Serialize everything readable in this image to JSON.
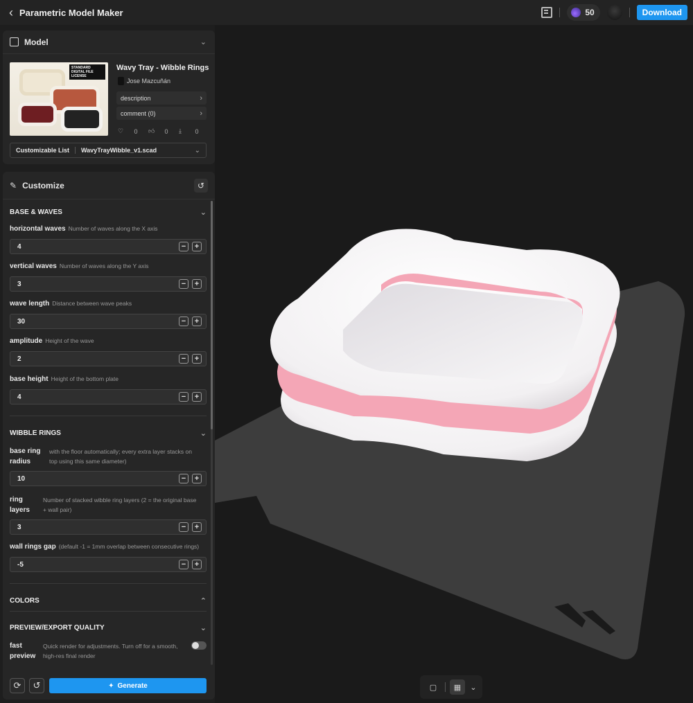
{
  "header": {
    "title": "Parametric Model Maker",
    "credits": "50",
    "download_label": "Download"
  },
  "model": {
    "panel_title": "Model",
    "name": "Wavy Tray - Wibble Rings",
    "author": "Jose Mazcuñán",
    "license_badge": "STANDARD DIGITAL FILE LICENSE",
    "description_label": "description",
    "comment_label": "comment  (0)",
    "likes": "0",
    "thumbs": "0",
    "downloads": "0",
    "file_list_label": "Customizable List",
    "file_name": "WavyTrayWibble_v1.scad"
  },
  "customize": {
    "panel_title": "Customize",
    "sections": {
      "base_waves": "BASE & WAVES",
      "wibble_rings": "WIBBLE RINGS",
      "colors": "COLORS",
      "quality": "PREVIEW/EXPORT QUALITY"
    },
    "params": {
      "horizontal_waves": {
        "label": "horizontal waves",
        "desc": "Number of waves along the X axis",
        "value": "4"
      },
      "vertical_waves": {
        "label": "vertical waves",
        "desc": "Number of waves along the Y axis",
        "value": "3"
      },
      "wave_length": {
        "label": "wave length",
        "desc": "Distance between wave peaks",
        "value": "30"
      },
      "amplitude": {
        "label": "amplitude",
        "desc": "Height of the wave",
        "value": "2"
      },
      "base_height": {
        "label": "base height",
        "desc": "Height of the bottom plate",
        "value": "4"
      },
      "base_ring_radius": {
        "label_1": "base ring",
        "label_2": "radius",
        "desc_1": "with the floor automatically; every extra layer stacks on",
        "desc_2": "top using this same diameter)",
        "value": "10"
      },
      "ring_layers": {
        "label_1": "ring",
        "label_2": "layers",
        "desc_1": "Number of stacked wibble ring layers (2 = the original base",
        "desc_2": "+ wall pair)",
        "value": "3"
      },
      "wall_rings_gap": {
        "label": "wall rings gap",
        "desc": "(default -1 = 1mm overlap between consecutive rings)",
        "value": "-5"
      },
      "fast_preview": {
        "label_1": "fast",
        "label_2": "preview",
        "desc_1": "Quick render for adjustments. Turn off for a smooth,",
        "desc_2": "high-res final render",
        "enabled": false
      }
    },
    "generate_label": "Generate"
  },
  "viewer": {
    "tray_colors": {
      "ring": "#ffffff",
      "accent": "#f4a6b6",
      "floor": "#eceaec"
    },
    "bed_color": "#3d3d3d",
    "background": "#1a1a1a"
  }
}
